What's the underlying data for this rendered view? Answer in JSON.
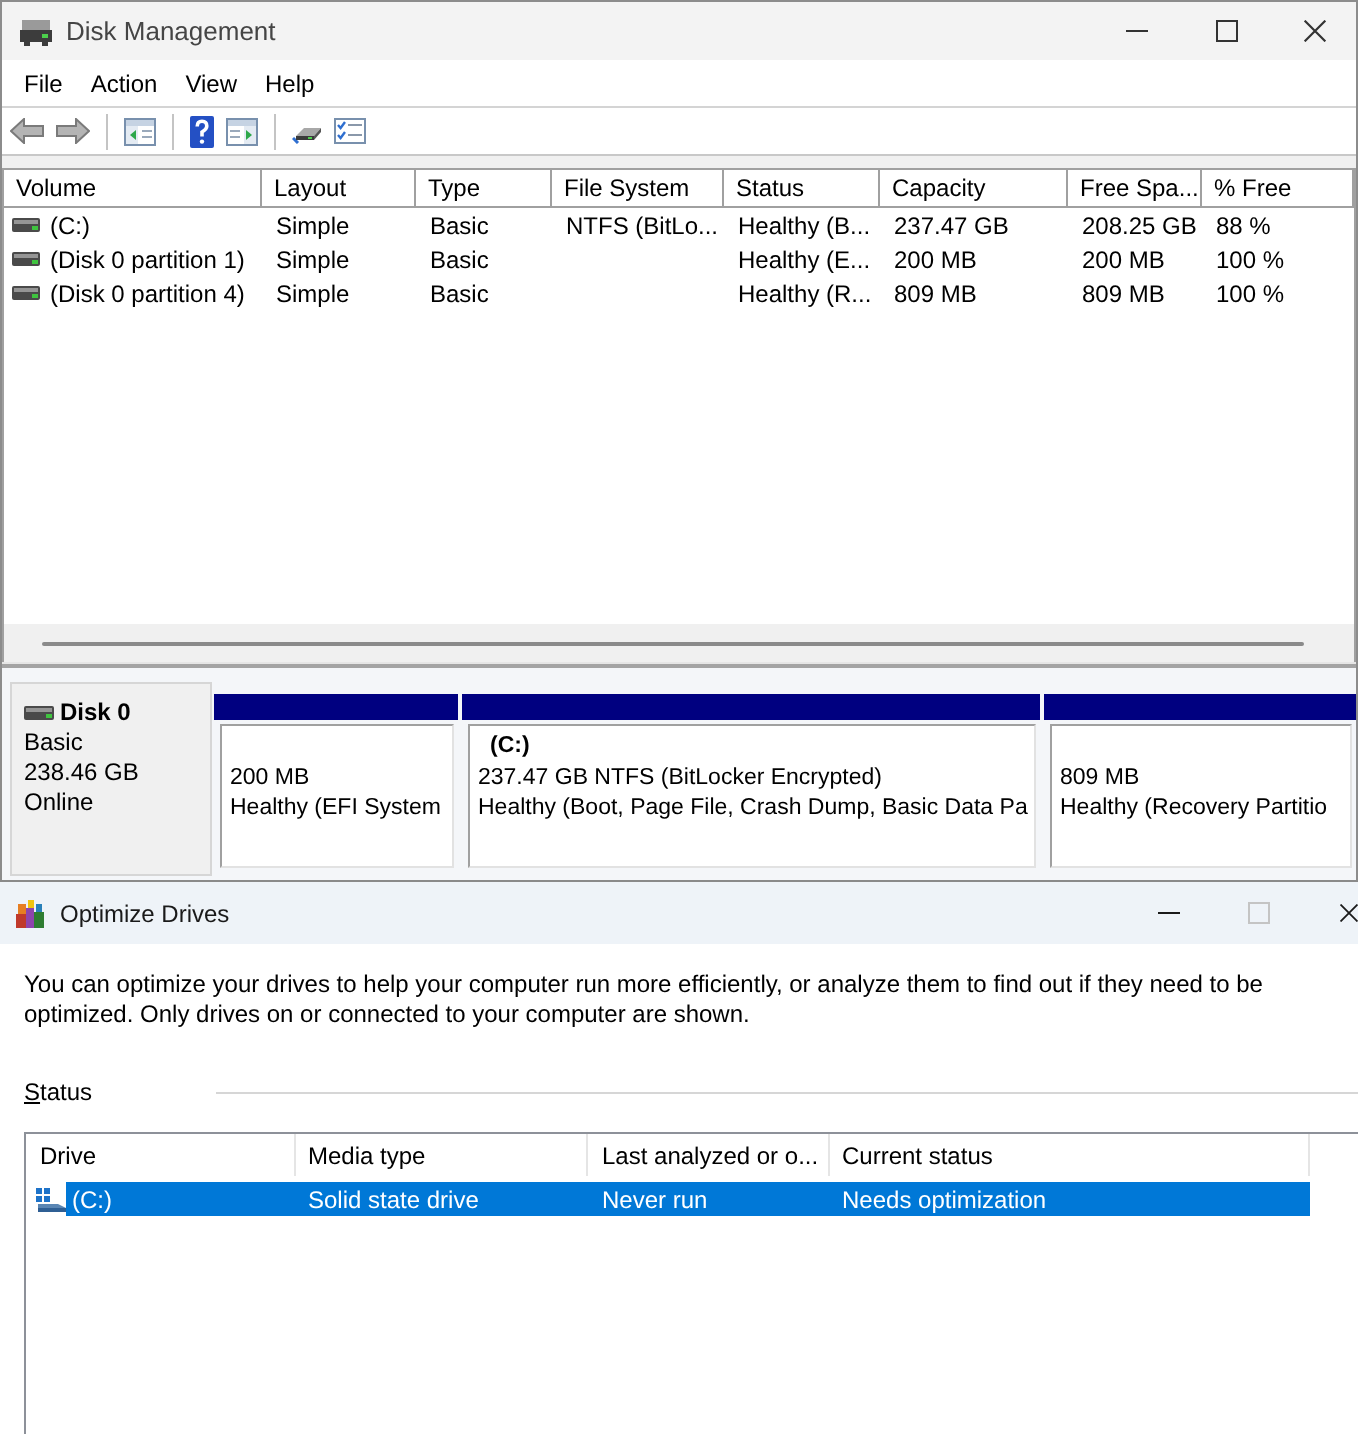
{
  "disk_management": {
    "title": "Disk Management",
    "menu": [
      {
        "label": "File"
      },
      {
        "label": "Action"
      },
      {
        "label": "View"
      },
      {
        "label": "Help"
      }
    ],
    "volume_table": {
      "columns": [
        "Volume",
        "Layout",
        "Type",
        "File System",
        "Status",
        "Capacity",
        "Free Spa...",
        "% Free"
      ],
      "rows": [
        {
          "selected": false,
          "cells": [
            "(C:)",
            "Simple",
            "Basic",
            "NTFS (BitLo...",
            "Healthy (B...",
            "237.47 GB",
            "208.25 GB",
            "88 %"
          ]
        },
        {
          "selected": false,
          "cells": [
            "(Disk 0 partition 1)",
            "Simple",
            "Basic",
            null,
            "Healthy (E...",
            "200 MB",
            "200 MB",
            "100 %"
          ]
        },
        {
          "selected": false,
          "cells": [
            "(Disk 0 partition 4)",
            "Simple",
            "Basic",
            null,
            "Healthy (R...",
            "809 MB",
            "809 MB",
            "100 %"
          ]
        }
      ]
    },
    "disks": [
      {
        "name": "Disk 0",
        "type": "Basic",
        "size": "238.46 GB",
        "state": "Online",
        "partitions": [
          {
            "size": "200 MB",
            "status": "Healthy (EFI System"
          },
          {
            "label": "(C:)",
            "size": "237.47 GB NTFS (BitLocker Encrypted)",
            "status": "Healthy (Boot, Page File, Crash Dump, Basic Data Pa"
          },
          {
            "size": "809 MB",
            "status": "Healthy (Recovery Partitio"
          }
        ]
      }
    ]
  },
  "optimize_drives": {
    "title": "Optimize Drives",
    "maximize_disabled": true,
    "description": "You can optimize your drives to help your computer run more efficiently, or analyze them to find out if they need to be optimized. Only drives on or connected to your computer are shown.",
    "section_label": "Status",
    "drive_table": {
      "columns": [
        "Drive",
        "Media type",
        "Last analyzed or o...",
        "Current status"
      ],
      "rows": [
        {
          "selected": true,
          "cells": [
            "(C:)",
            "Solid state drive",
            "Never run",
            "Needs optimization"
          ]
        }
      ]
    }
  }
}
